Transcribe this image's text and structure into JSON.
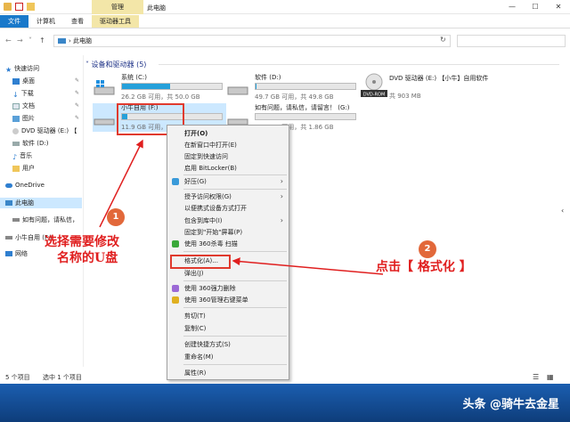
{
  "titlebar": {
    "context_group": "管理",
    "title": "此电脑",
    "controls": [
      "—",
      "☐",
      "✕"
    ]
  },
  "ribbon": {
    "tabs": [
      "文件",
      "计算机",
      "查看",
      "驱动器工具"
    ]
  },
  "address": {
    "path": "此电脑",
    "search_placeholder": ""
  },
  "sidebar": {
    "quick_access": "快速访问",
    "items": [
      "桌面",
      "下载",
      "文档",
      "图片",
      "DVD 驱动器 (E:) 【",
      "软件 (D:)",
      "音乐",
      "用户"
    ],
    "onedrive": "OneDrive",
    "this_pc": "此电脑",
    "drive_g": "如有问题，请私信，",
    "drive_f": "小牛自用 (F:)",
    "network": "网络"
  },
  "section": {
    "title": "设备和驱动器 (5)"
  },
  "drives": [
    {
      "name": "系统 (C:)",
      "info": "26.2 GB 可用，共 50.0 GB",
      "used_fraction": 0.48
    },
    {
      "name": "软件 (D:)",
      "info": "49.7 GB 可用，共 49.8 GB",
      "used_fraction": 0.01
    },
    {
      "name": "小牛自用 (F:)",
      "info": "11.9 GB 可用，",
      "used_fraction": 0.05
    },
    {
      "name": "如有问题，请私信，请留言！ (G:)",
      "info": "1.86 GB 可用，共 1.86 GB",
      "used_fraction": 0.0
    }
  ],
  "dvd": {
    "name": "DVD 驱动器 (E:) 【小牛】自用软件",
    "info": "共 903 MB",
    "label": "DVD-ROM"
  },
  "context_menu": {
    "items": [
      {
        "label": "打开(O)",
        "bold": true
      },
      {
        "label": "在新窗口中打开(E)"
      },
      {
        "label": "固定到快速访问"
      },
      {
        "label": "启用 BitLocker(B)"
      },
      {
        "label": "好压(G)",
        "submenu": true
      },
      {
        "label": "授予访问权限(G)",
        "submenu": true
      },
      {
        "label": "以便携式设备方式打开"
      },
      {
        "label": "包含到库中(I)",
        "submenu": true
      },
      {
        "label": "固定到\"开始\"屏幕(P)"
      },
      {
        "label": "使用 360杀毒 扫描"
      },
      {
        "label": "格式化(A)..."
      },
      {
        "label": "弹出(J)"
      },
      {
        "label": "使用 360强力删除"
      },
      {
        "label": "使用 360管理右键菜单"
      },
      {
        "label": "剪切(T)"
      },
      {
        "label": "复制(C)"
      },
      {
        "label": "创建快捷方式(S)"
      },
      {
        "label": "重命名(M)"
      },
      {
        "label": "属性(R)"
      }
    ]
  },
  "status": {
    "count": "5 个项目",
    "selected": "选中 1 个项目"
  },
  "annotations": {
    "badge1": "1",
    "badge2": "2",
    "step1_line1": "选择需要修改",
    "step1_line2": "名称的U盘",
    "step2": "点击【 格式化 】"
  },
  "watermark": "头条 @骑牛去金星",
  "colors": {
    "accent": "#1979ca",
    "annotation_red": "#e01f1f",
    "badge": "#e2683a",
    "selection": "#cce8ff",
    "drive_fill": "#26a0da"
  }
}
